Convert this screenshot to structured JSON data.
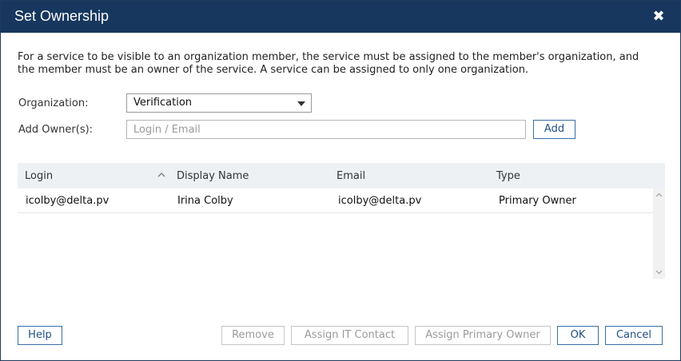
{
  "dialog": {
    "title": "Set Ownership",
    "close_glyph": "✖",
    "description": "For a service to be visible to an organization member, the service must be assigned to the member's organization, and the member must be an owner of the service. A service can be assigned to only one organization."
  },
  "form": {
    "organization_label": "Organization:",
    "organization_value": "Verification",
    "add_owner_label": "Add Owner(s):",
    "add_owner_placeholder": "Login / Email",
    "add_owner_value": "",
    "add_button": "Add"
  },
  "table": {
    "columns": [
      "Login",
      "Display Name",
      "Email",
      "Type"
    ],
    "sorted_column": "Login",
    "rows": [
      {
        "login": "icolby@delta.pv",
        "display_name": "Irina Colby",
        "email": "icolby@delta.pv",
        "type": "Primary Owner"
      }
    ]
  },
  "footer": {
    "help": "Help",
    "remove": "Remove",
    "assign_it_contact": "Assign IT Contact",
    "assign_primary_owner": "Assign Primary Owner",
    "ok": "OK",
    "cancel": "Cancel"
  },
  "icons": {
    "close": "close-icon",
    "dropdown": "chevron-down-icon",
    "sort": "sort-ascending-icon",
    "scroll_up": "scroll-up-icon",
    "scroll_down": "scroll-down-icon"
  },
  "colors": {
    "titlebar": "#17375e",
    "button_border": "#3a6ea5",
    "button_text": "#1f4f86",
    "disabled": "#9a9a9a",
    "grid_header": "#eef1f4"
  }
}
